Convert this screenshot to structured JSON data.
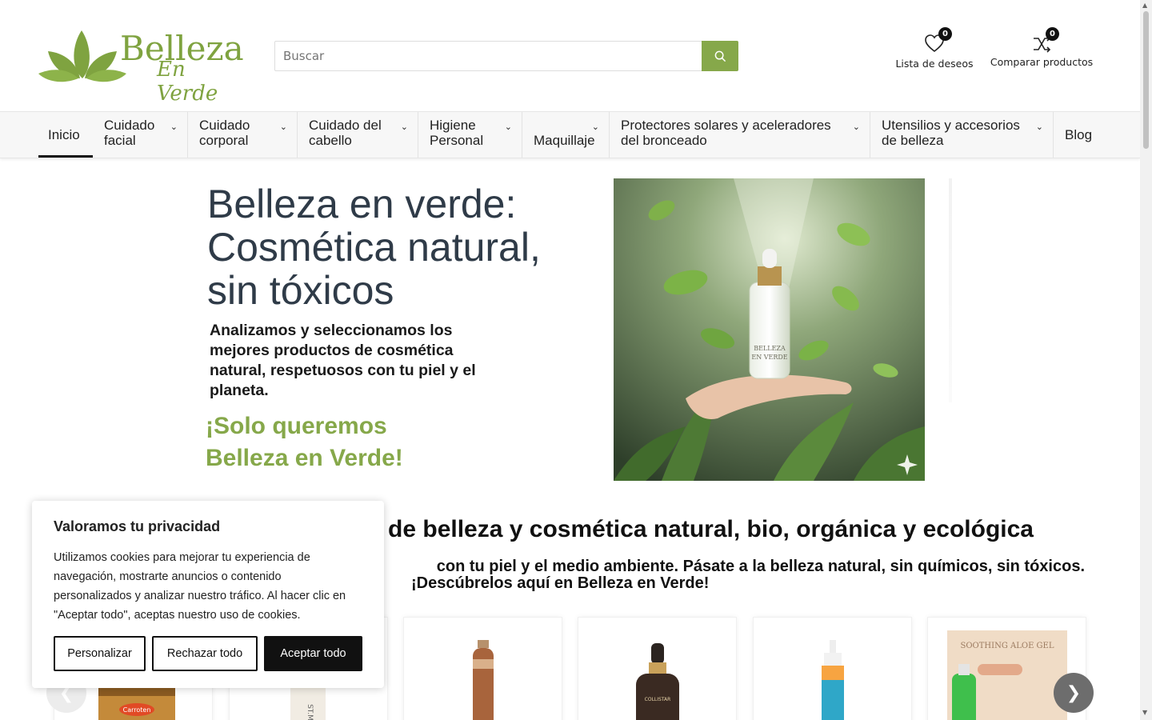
{
  "logo": {
    "title": "Belleza",
    "subtitle": "En Verde"
  },
  "search": {
    "placeholder": "Buscar"
  },
  "header_tools": {
    "wishlist": {
      "label": "Lista de deseos",
      "count": "0"
    },
    "compare": {
      "label": "Comparar productos",
      "count": "0"
    }
  },
  "nav": {
    "items": [
      {
        "label": "Inicio"
      },
      {
        "label": "Cuidado facial"
      },
      {
        "label": "Cuidado corporal"
      },
      {
        "label": "Cuidado del cabello"
      },
      {
        "label": "Higiene Personal"
      },
      {
        "label": "Maquillaje"
      },
      {
        "label": "Protectores solares y aceleradores del bronceado"
      },
      {
        "label": "Utensilios y accesorios de belleza"
      },
      {
        "label": "Blog"
      }
    ]
  },
  "hero": {
    "title": "Belleza en verde: Cosmética natural, sin tóxicos",
    "description": "Analizamos y seleccionamos los mejores productos de cosmética natural, respetuosos con tu piel y el planeta.",
    "slogan": "¡Solo queremos Belleza en Verde!",
    "bottle_label": "BELLEZA EN VERDE"
  },
  "section": {
    "title_visible": "s de belleza y cosmética natural, bio, orgánica y ecológica",
    "subtitle_line1": "con tu piel y el medio ambiente. Pásate a la belleza natural, sin químicos, sin tóxicos.",
    "subtitle_line2": "¡Descúbrelos aquí en Belleza en Verde!"
  },
  "products": {
    "labels": [
      "Carroten",
      "ST.MO",
      "",
      "COLLISTAR",
      "",
      "SOOTHING ALOE GEL"
    ]
  },
  "cookie": {
    "title": "Valoramos tu privacidad",
    "text": "Utilizamos cookies para mejorar tu experiencia de navegación, mostrarte anuncios o contenido personalizados y analizar nuestro tráfico. Al hacer clic en \"Aceptar todo\", aceptas nuestro uso de cookies.",
    "customize": "Personalizar",
    "reject": "Rechazar todo",
    "accept": "Aceptar todo"
  },
  "colors": {
    "brand_green": "#86a84a",
    "dark": "#111111",
    "title_gray": "#2f3b48"
  }
}
